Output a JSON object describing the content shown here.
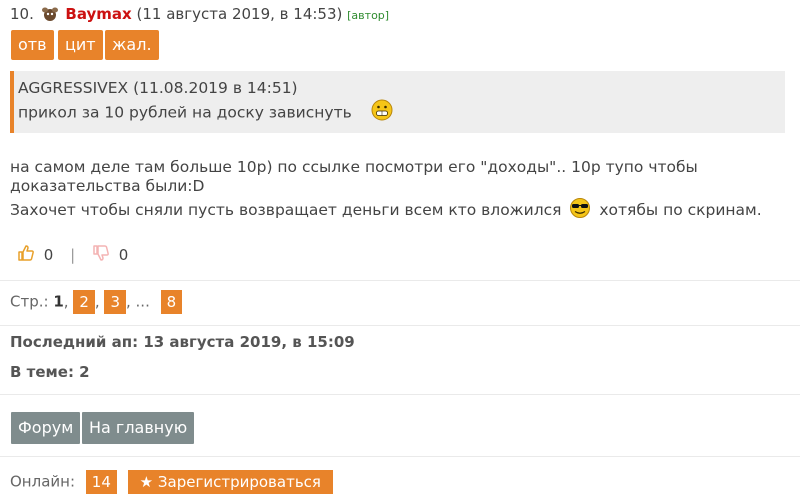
{
  "post": {
    "number": "10.",
    "author": "Baymax",
    "date": "(11 августа 2019, в 14:53)",
    "author_tag": "[автор]",
    "actions": [
      "отв",
      "цит",
      "жал."
    ]
  },
  "quote": {
    "header": "AGGRESSIVEX (11.08.2019 в 14:51)",
    "text": "прикол за 10 рублей на доску зависнуть"
  },
  "body": {
    "line1": "на самом деле там больше 10р) по ссылке посмотри его \"доходы\".. 10р тупо чтобы доказательства были:D",
    "line2a": "Захочет чтобы сняли пусть возвращает деньги всем кто вложился",
    "line2b": "хотябы по скринам."
  },
  "votes": {
    "likes": "0",
    "separator": "|",
    "dislikes": "0"
  },
  "pagination": {
    "label": "Стр.:",
    "current": "1",
    "pages": [
      "2",
      "3",
      "8"
    ],
    "ellipsis": ", ..."
  },
  "meta": {
    "last_update": "Последний ап: 13 августа 2019, в 15:09",
    "in_topic": "В теме: 2"
  },
  "nav": {
    "forum": "Форум",
    "home": "На главную"
  },
  "footer": {
    "label": "Онлайн:",
    "count": "14",
    "extra": "Зарегистрироваться"
  },
  "colors": {
    "accent": "#e8832a",
    "author": "#cc1111",
    "author_tag": "#2e8b2e",
    "gray_button": "#7f8c8d"
  }
}
